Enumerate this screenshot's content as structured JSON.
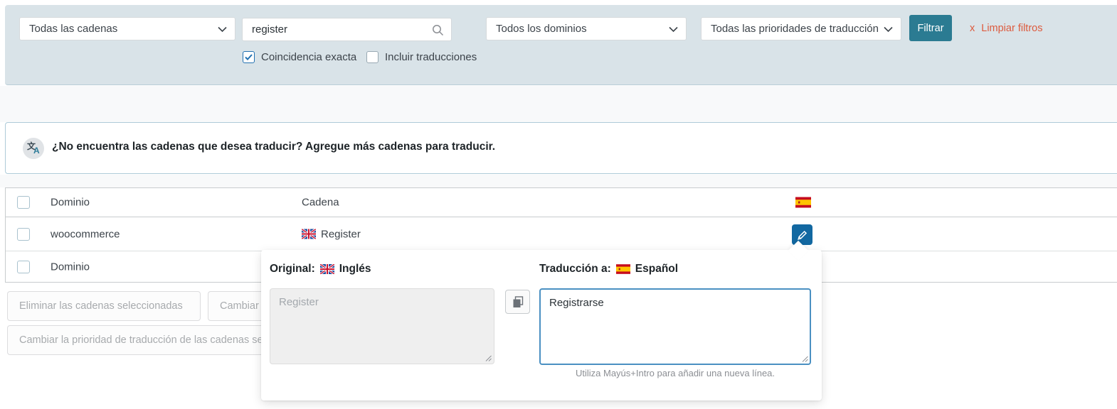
{
  "filters": {
    "strings_select": "Todas las cadenas",
    "search_value": "register",
    "domains_select": "Todos los dominios",
    "priorities_select": "Todas las prioridades de traducción",
    "filter_button_label": "Filtrar",
    "clear_x": "x",
    "clear_filters_label": "Limpiar filtros",
    "exact_match_label": "Coincidencia exacta",
    "include_translations_label": "Incluir traducciones"
  },
  "notice": {
    "text": "¿No encuentra las cadenas que desea traducir? Agregue más cadenas para traducir."
  },
  "table": {
    "columns": {
      "domain": "Dominio",
      "string": "Cadena"
    },
    "rows": [
      {
        "domain": "woocommerce",
        "string": "Register"
      }
    ],
    "footer": {
      "domain": "Dominio"
    }
  },
  "bulk_actions": {
    "delete_selected_label": "Eliminar las cadenas seleccionadas",
    "change_domain_label": "Cambiar",
    "change_priority_label": "Cambiar la prioridad de traducción de las cadenas sele"
  },
  "editor": {
    "original_label": "Original:",
    "original_language": "Inglés",
    "translation_label": "Traducción a:",
    "translation_language": "Español",
    "original_placeholder": "Register",
    "translation_value": "Registrarse",
    "helper_text": "Utiliza Mayús+Intro para añadir una nueva línea."
  },
  "icons": {
    "translate_zh": "文",
    "translate_a": "A"
  },
  "colors": {
    "panel_bg": "#d9e3e8",
    "filter_button": "#2b7b92",
    "clear_link": "#dd5b3e",
    "edit_button": "#1268a1",
    "focus_border": "#4a90c2",
    "check_blue": "#2271b1"
  }
}
